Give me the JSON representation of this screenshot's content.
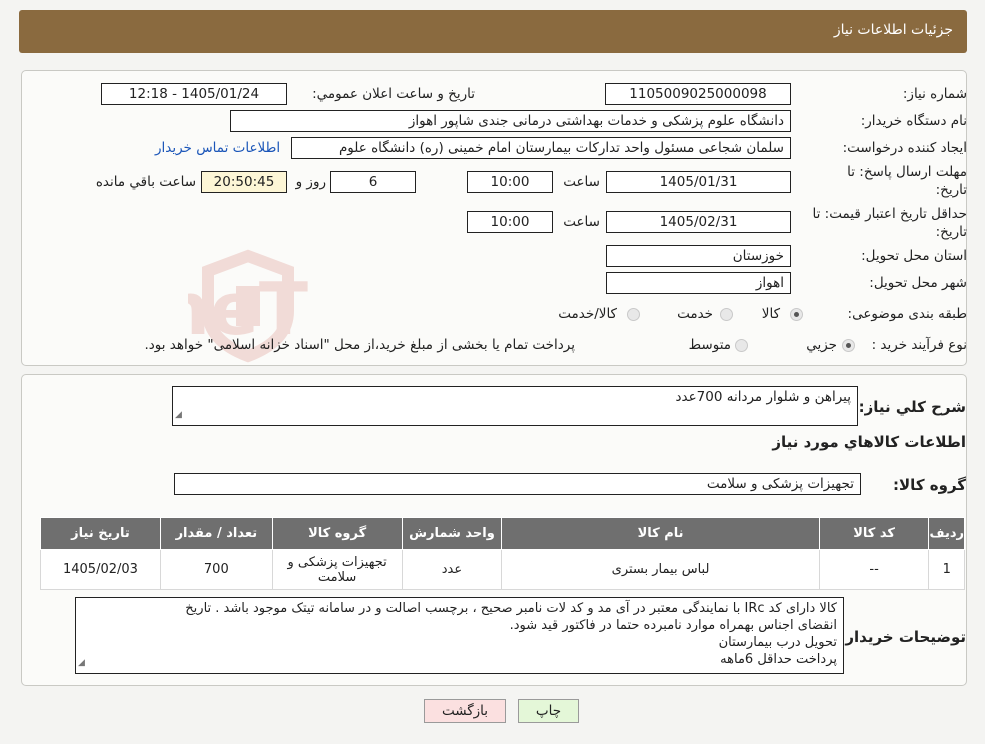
{
  "header": {
    "title": "جزئیات اطلاعات نیاز"
  },
  "watermark": {
    "text": "AriaTender.neT",
    "color": "#c0392b"
  },
  "form": {
    "need_number": {
      "label": "شماره نیاز:",
      "value": "1105009025000098"
    },
    "announce_datetime": {
      "label": "تاریخ و ساعت اعلان عمومي:",
      "value": "1405/01/24 - 12:18"
    },
    "buyer_org": {
      "label": "نام دستگاه خریدار:",
      "value": "دانشگاه علوم پزشکی و خدمات بهداشتی درمانی جندی شاپور اهواز"
    },
    "requester": {
      "label": "ایجاد کننده درخواست:",
      "value": "سلمان شجاعی مسئول واحد تدارکات بیمارستان امام خمینی (ره) دانشگاه علوم",
      "contact_link": "اطلاعات تماس خریدار"
    },
    "response_deadline": {
      "label_line1": "مهلت ارسال پاسخ: تا",
      "label_line2": "تاریخ:",
      "date": "1405/01/31",
      "time_label": "ساعت",
      "time": "10:00",
      "days": "6",
      "days_label": "روز و",
      "remaining": "20:50:45",
      "remaining_label": "ساعت باقي مانده"
    },
    "price_validity": {
      "label_line1": "حداقل تاریخ اعتبار قیمت: تا",
      "label_line2": "تاریخ:",
      "date": "1405/02/31",
      "time_label": "ساعت",
      "time": "10:00"
    },
    "province": {
      "label": "استان محل تحویل:",
      "value": "خوزستان"
    },
    "city": {
      "label": "شهر محل تحویل:",
      "value": "اهواز"
    },
    "category": {
      "label": "طبقه بندی موضوعی:",
      "options": [
        "کالا",
        "خدمت",
        "کالا/خدمت"
      ],
      "selected": "کالا"
    },
    "purchase_type": {
      "label": "نوع فرآیند خرید :",
      "options": [
        "جزیي",
        "متوسط"
      ],
      "selected": "جزیي",
      "note": "پرداخت تمام یا بخشی از مبلغ خرید،از محل \"اسناد خزانه اسلامی\" خواهد بود."
    }
  },
  "summary": {
    "label": "شرح کلي نیاز:",
    "value": "پیراهن و شلوار مردانه     700عدد",
    "goods_info_title": "اطلاعات کالاهاي مورد نیاز",
    "group_label": "گروه کالا:",
    "group_value": "تجهیزات پزشکی و سلامت"
  },
  "table": {
    "headers": [
      "ردیف",
      "کد کالا",
      "نام کالا",
      "واحد شمارش",
      "گروه کالا",
      "تعداد / مقدار",
      "تاریخ نیاز"
    ],
    "rows": [
      [
        "1",
        "--",
        "لباس بیمار بستری",
        "عدد",
        "تجهیزات پزشکی و سلامت",
        "700",
        "1405/02/03"
      ]
    ]
  },
  "buyer_notes": {
    "label": "توضیحات خریدار:",
    "lines": [
      "کالا دارای کد IRc با نمایندگی معتبر در آی مد و کد لات نامبر صحیح ، برچسب اصالت و در سامانه تیتک موجود باشد . تاریخ",
      "انقضای اجناس بهمراه موارد نامبرده حتما در فاکتور قید شود.",
      "تحویل درب بیمارستان",
      "پرداخت حداقل 6ماهه"
    ]
  },
  "buttons": {
    "print": "چاپ",
    "back": "بازگشت"
  },
  "colors": {
    "header": "#8a6a3f",
    "link": "#1a55b8",
    "table_header": "#6f6f6f"
  }
}
